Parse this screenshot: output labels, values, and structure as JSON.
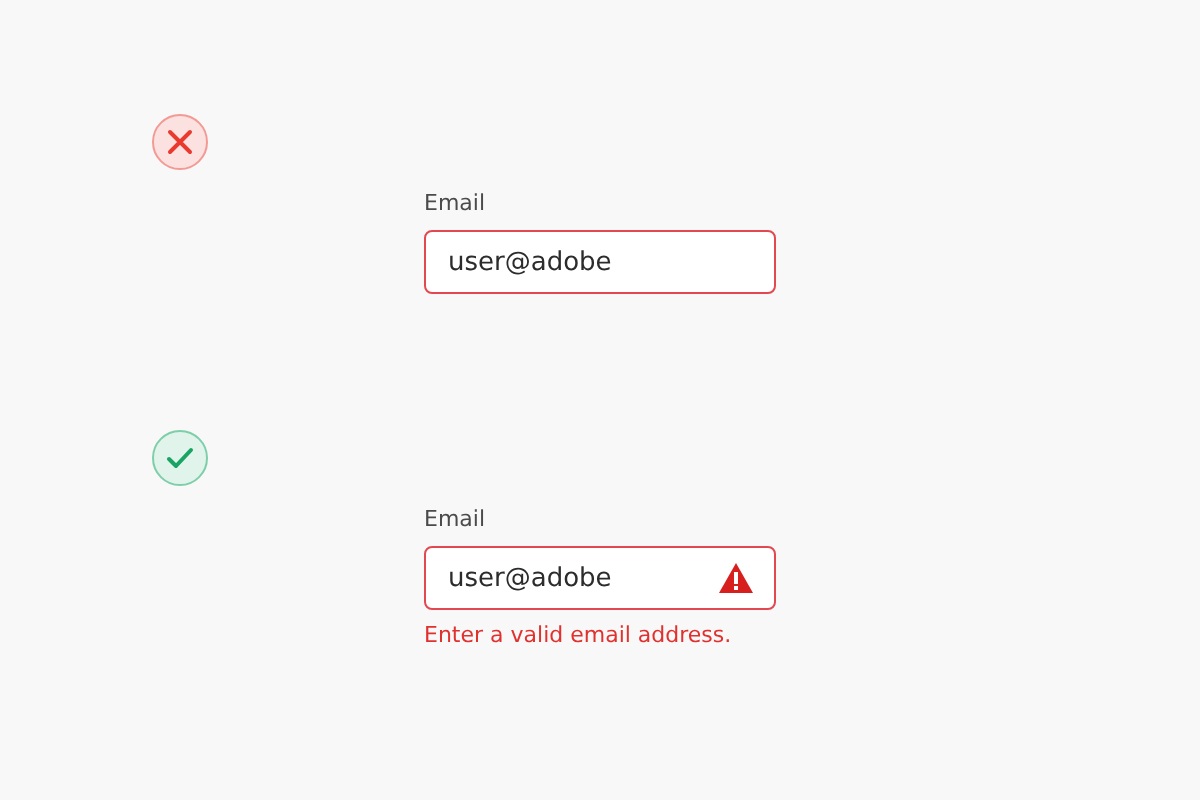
{
  "examples": [
    {
      "kind": "dont",
      "label": "Email",
      "value": "user@adobe",
      "warning": false
    },
    {
      "kind": "do",
      "label": "Email",
      "value": "user@adobe",
      "warning": true,
      "error": "Enter a valid email address."
    }
  ]
}
